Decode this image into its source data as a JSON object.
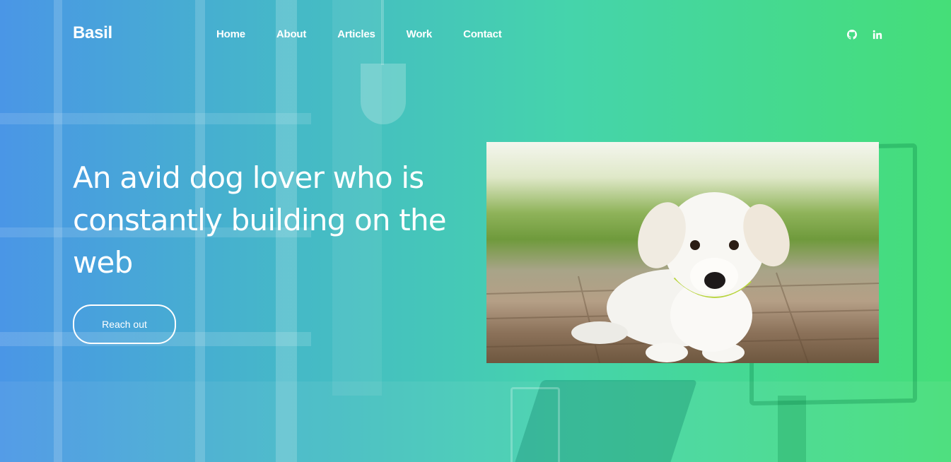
{
  "brand": "Basil",
  "nav": {
    "items": [
      {
        "label": "Home"
      },
      {
        "label": "About"
      },
      {
        "label": "Articles"
      },
      {
        "label": "Work"
      },
      {
        "label": "Contact"
      }
    ]
  },
  "social": {
    "items": [
      {
        "icon": "github-icon"
      },
      {
        "icon": "linkedin-icon"
      }
    ]
  },
  "hero": {
    "headline": "An avid dog lover who is constantly building on the web",
    "cta_label": "Reach out",
    "image": {
      "subject": "puppy-photo"
    }
  },
  "colors": {
    "gradient_start": "#4a96e6",
    "gradient_end": "#45de78",
    "text": "#ffffff"
  }
}
